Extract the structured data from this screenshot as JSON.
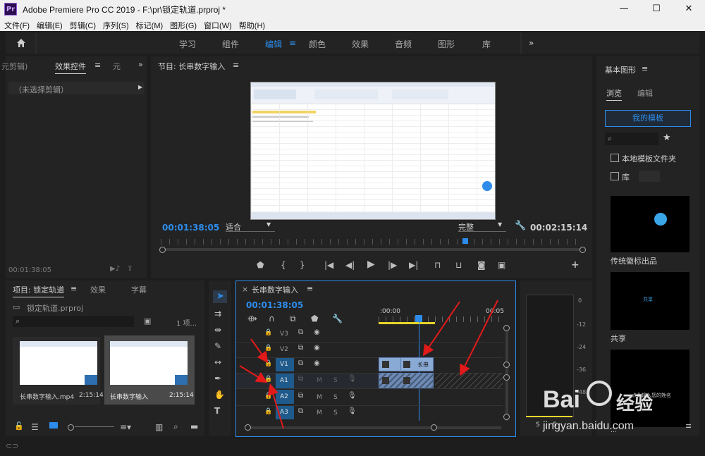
{
  "window": {
    "title": "Adobe Premiere Pro CC 2019 - F:\\pr\\锁定轨道.prproj *",
    "app_icon": "Pr",
    "minimize": "—",
    "maximize": "☐",
    "close": "✕"
  },
  "menu": [
    "文件(F)",
    "编辑(E)",
    "剪辑(C)",
    "序列(S)",
    "标记(M)",
    "图形(G)",
    "窗口(W)",
    "帮助(H)"
  ],
  "workspaces": {
    "items": [
      "学习",
      "组件",
      "编辑",
      "颜色",
      "效果",
      "音频",
      "图形",
      "库"
    ],
    "active": "编辑",
    "active_menu_icon": "≡",
    "more": "»"
  },
  "source_panel": {
    "tabs": [
      "元剪辑)",
      "效果控件",
      "元"
    ],
    "active_tab": "效果控件",
    "tab_menu": "≡",
    "more": "»",
    "no_clip": "（未选择剪辑）",
    "timecode": "00:01:38:05"
  },
  "program_monitor": {
    "title": "节目: 长串数字输入",
    "menu": "≡",
    "timecode_current": "00:01:38:05",
    "fit_select": "适合",
    "quality_select": "完整",
    "timecode_duration": "00:02:15:14"
  },
  "essential_graphics": {
    "title": "基本图形",
    "menu": "≡",
    "tabs": [
      "浏览",
      "编辑"
    ],
    "active_tab": "浏览",
    "my_templates": "我的模板",
    "local_templates": "本地模板文件夹",
    "library_label": "库",
    "templates": [
      {
        "label": "传统徽标出品"
      },
      {
        "label": "共享",
        "thumb_text": "共享"
      },
      {
        "label": "...",
        "thumb_text": "点此输入您的姓名"
      }
    ]
  },
  "project_panel": {
    "tabs": [
      "项目: 锁定轨道",
      "效果",
      "字幕"
    ],
    "active_tab": "项目: 锁定轨道",
    "menu": "≡",
    "file": "锁定轨道.prproj",
    "count": "1 项...",
    "items": [
      {
        "name": "长串数字输入.mp4",
        "duration": "2:15:14"
      },
      {
        "name": "长串数字输入",
        "duration": "2:15:14"
      }
    ]
  },
  "timeline": {
    "tab": "长串数字输入",
    "close": "×",
    "menu": "≡",
    "timecode": "00:01:38:05",
    "ruler_start": ":00:00",
    "ruler_mark": "00:05",
    "tracks": [
      {
        "id": "V3",
        "type": "video"
      },
      {
        "id": "V2",
        "type": "video"
      },
      {
        "id": "V1",
        "type": "video"
      },
      {
        "id": "A1",
        "type": "audio"
      },
      {
        "id": "A2",
        "type": "audio"
      },
      {
        "id": "A3",
        "type": "audio"
      }
    ],
    "m_label": "M",
    "s_label": "S",
    "clip_label": "长串"
  },
  "audio_meter": {
    "scale": [
      "0",
      "-12",
      "-24",
      "-36",
      "-48"
    ],
    "solo": [
      "S",
      "S"
    ]
  },
  "watermark": {
    "logo": "Bai",
    "logo2": "经验",
    "url": "jingyan.baidu.com"
  },
  "colors": {
    "accent": "#2d8ceb",
    "panel": "#232323",
    "background": "#1d1d1d",
    "arrow": "#e21a1a",
    "clip": "#8aaad6"
  }
}
